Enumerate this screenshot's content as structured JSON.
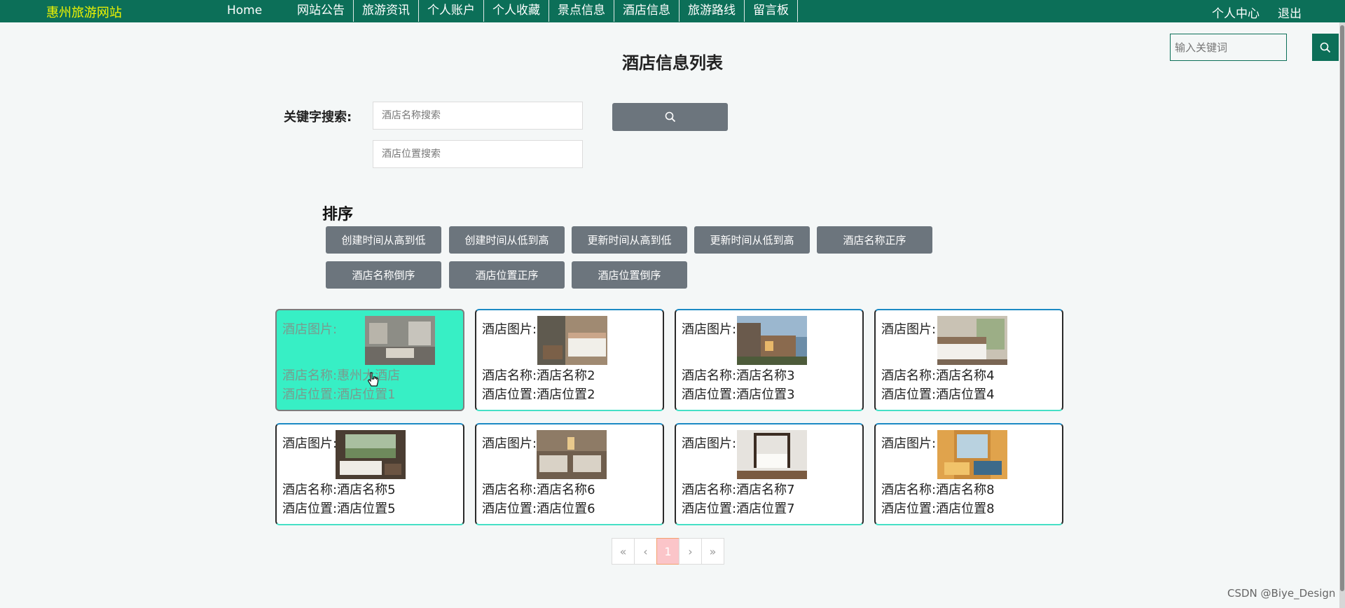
{
  "nav": {
    "brand": "惠州旅游网站",
    "home": "Home",
    "items": [
      "网站公告",
      "旅游资讯",
      "个人账户",
      "个人收藏",
      "景点信息",
      "酒店信息",
      "旅游路线",
      "留言板"
    ],
    "right": [
      "个人中心",
      "退出"
    ]
  },
  "top_search": {
    "placeholder": "输入关键词"
  },
  "page": {
    "title": "酒店信息列表"
  },
  "search": {
    "label": "关键字搜索:",
    "name_placeholder": "酒店名称搜索",
    "location_placeholder": "酒店位置搜索"
  },
  "sort": {
    "title": "排序",
    "buttons": [
      "创建时间从高到低",
      "创建时间从低到高",
      "更新时间从高到低",
      "更新时间从低到高",
      "酒店名称正序",
      "酒店名称倒序",
      "酒店位置正序",
      "酒店位置倒序"
    ]
  },
  "hotels": [
    {
      "image_label": "酒店图片:",
      "name": "酒店名称:惠州大酒店",
      "location": "酒店位置:酒店位置1"
    },
    {
      "image_label": "酒店图片:",
      "name": "酒店名称:酒店名称2",
      "location": "酒店位置:酒店位置2"
    },
    {
      "image_label": "酒店图片:",
      "name": "酒店名称:酒店名称3",
      "location": "酒店位置:酒店位置3"
    },
    {
      "image_label": "酒店图片:",
      "name": "酒店名称:酒店名称4",
      "location": "酒店位置:酒店位置4"
    },
    {
      "image_label": "酒店图片:",
      "name": "酒店名称:酒店名称5",
      "location": "酒店位置:酒店位置5"
    },
    {
      "image_label": "酒店图片:",
      "name": "酒店名称:酒店名称6",
      "location": "酒店位置:酒店位置6"
    },
    {
      "image_label": "酒店图片:",
      "name": "酒店名称:酒店名称7",
      "location": "酒店位置:酒店位置7"
    },
    {
      "image_label": "酒店图片:",
      "name": "酒店名称:酒店名称8",
      "location": "酒店位置:酒店位置8"
    }
  ],
  "pagination": {
    "first": "«",
    "prev": "‹",
    "current": "1",
    "next": "›",
    "last": "»"
  },
  "watermark": "CSDN @Biye_Design",
  "colors": {
    "nav_bg": "#0c6f58",
    "brand": "#f0f500",
    "button_gray": "#6c757d",
    "active_card": "#37efc5",
    "current_page": "#fbc5c9"
  }
}
